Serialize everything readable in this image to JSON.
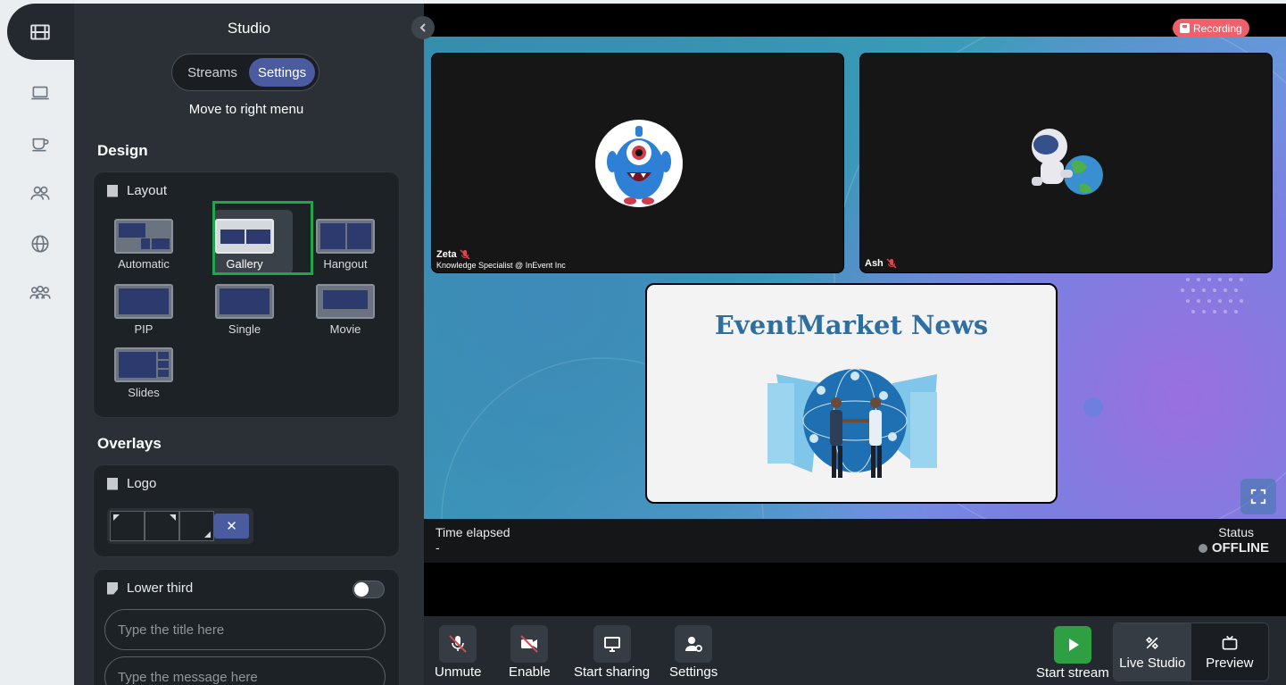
{
  "panel": {
    "title": "Studio",
    "tabs": {
      "streams": "Streams",
      "settings": "Settings"
    },
    "move_to_right": "Move to right menu",
    "design_title": "Design",
    "overlays_title": "Overlays",
    "layout_card_title": "Layout",
    "layouts": [
      {
        "label": "Automatic"
      },
      {
        "label": "Gallery"
      },
      {
        "label": "Hangout"
      },
      {
        "label": "PIP"
      },
      {
        "label": "Single"
      },
      {
        "label": "Movie"
      },
      {
        "label": "Slides"
      }
    ],
    "selected_layout": "Gallery",
    "logo_card_title": "Logo",
    "logo_remove": "✕",
    "lower_third_title": "Lower third",
    "lower_third_title_placeholder": "Type the title here",
    "lower_third_message_placeholder": "Type the message here"
  },
  "stage": {
    "recording_label": "Recording",
    "participants": [
      {
        "name": "Zeta",
        "subtitle": "Knowledge Specialist @ InEvent Inc"
      },
      {
        "name": "Ash",
        "subtitle": ""
      }
    ],
    "slide_title": "EventMarket News"
  },
  "status": {
    "time_elapsed_label": "Time elapsed",
    "time_elapsed_value": "-",
    "status_label": "Status",
    "status_value": "OFFLINE"
  },
  "controls": {
    "unmute": "Unmute",
    "enable": "Enable",
    "start_sharing": "Start sharing",
    "settings": "Settings",
    "start_stream": "Start stream",
    "live_studio": "Live Studio",
    "preview": "Preview"
  },
  "colors": {
    "accent": "#4b5ba0",
    "selection": "#1fa64a",
    "recording": "#f0606a",
    "go_live": "#2ea043"
  }
}
